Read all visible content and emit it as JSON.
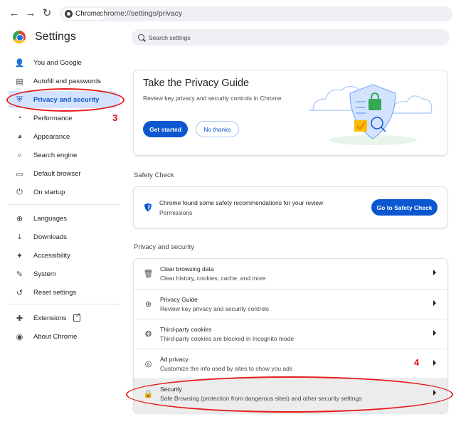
{
  "browser": {
    "chip_label": "Chrome",
    "url": "chrome://settings/privacy",
    "back": "←",
    "forward": "→",
    "reload": "↻"
  },
  "sidebar": {
    "title": "Settings",
    "items": [
      {
        "label": "You and Google",
        "icon": "person-icon",
        "glyph": "👤"
      },
      {
        "label": "Autofill and passwords",
        "icon": "clipboard-icon",
        "glyph": "▤"
      },
      {
        "label": "Privacy and security",
        "icon": "shield-icon",
        "glyph": "⛨"
      },
      {
        "label": "Performance",
        "icon": "speedometer-icon",
        "glyph": "◔"
      },
      {
        "label": "Appearance",
        "icon": "palette-icon",
        "glyph": "◕"
      },
      {
        "label": "Search engine",
        "icon": "search-icon",
        "glyph": "⌕"
      },
      {
        "label": "Default browser",
        "icon": "browser-icon",
        "glyph": "▭"
      },
      {
        "label": "On startup",
        "icon": "power-icon",
        "glyph": "⏻"
      },
      {
        "label": "Languages",
        "icon": "globe-icon",
        "glyph": "⊕"
      },
      {
        "label": "Downloads",
        "icon": "download-icon",
        "glyph": "⤓"
      },
      {
        "label": "Accessibility",
        "icon": "accessibility-icon",
        "glyph": "✦"
      },
      {
        "label": "System",
        "icon": "wrench-icon",
        "glyph": "✎"
      },
      {
        "label": "Reset settings",
        "icon": "reset-icon",
        "glyph": "↺"
      },
      {
        "label": "Extensions",
        "icon": "puzzle-icon",
        "glyph": "✚"
      },
      {
        "label": "About Chrome",
        "icon": "chrome-icon",
        "glyph": "◉"
      }
    ]
  },
  "search": {
    "placeholder": "Search settings"
  },
  "privacy_guide": {
    "title": "Take the Privacy Guide",
    "description": "Review key privacy and security controls in Chrome",
    "primary_label": "Get started",
    "secondary_label": "No thanks"
  },
  "safety_check": {
    "section_title": "Safety Check",
    "message": "Chrome found some safety recommendations for your review",
    "sub": "Permissions",
    "button_label": "Go to Safety Check"
  },
  "privacy_section": {
    "section_title": "Privacy and security",
    "rows": [
      {
        "title": "Clear browsing data",
        "desc": "Clear history, cookies, cache, and more",
        "icon": "trash-icon",
        "glyph": "🗑"
      },
      {
        "title": "Privacy Guide",
        "desc": "Review key privacy and security controls",
        "icon": "compass-icon",
        "glyph": "⊛"
      },
      {
        "title": "Third-party cookies",
        "desc": "Third-party cookies are blocked in Incognito mode",
        "icon": "cookie-icon",
        "glyph": "❂"
      },
      {
        "title": "Ad privacy",
        "desc": "Customize the info used by sites to show you ads",
        "icon": "ad-privacy-icon",
        "glyph": "◎"
      },
      {
        "title": "Security",
        "desc": "Safe Browsing (protection from dangerous sites) and other security settings",
        "icon": "lock-icon",
        "glyph": "🔒"
      }
    ]
  },
  "annotations": {
    "step3": "3",
    "step4": "4",
    "color": "#e10f0f"
  },
  "colors": {
    "accent": "#0b57d0",
    "active_bg": "#d3e3fd"
  }
}
